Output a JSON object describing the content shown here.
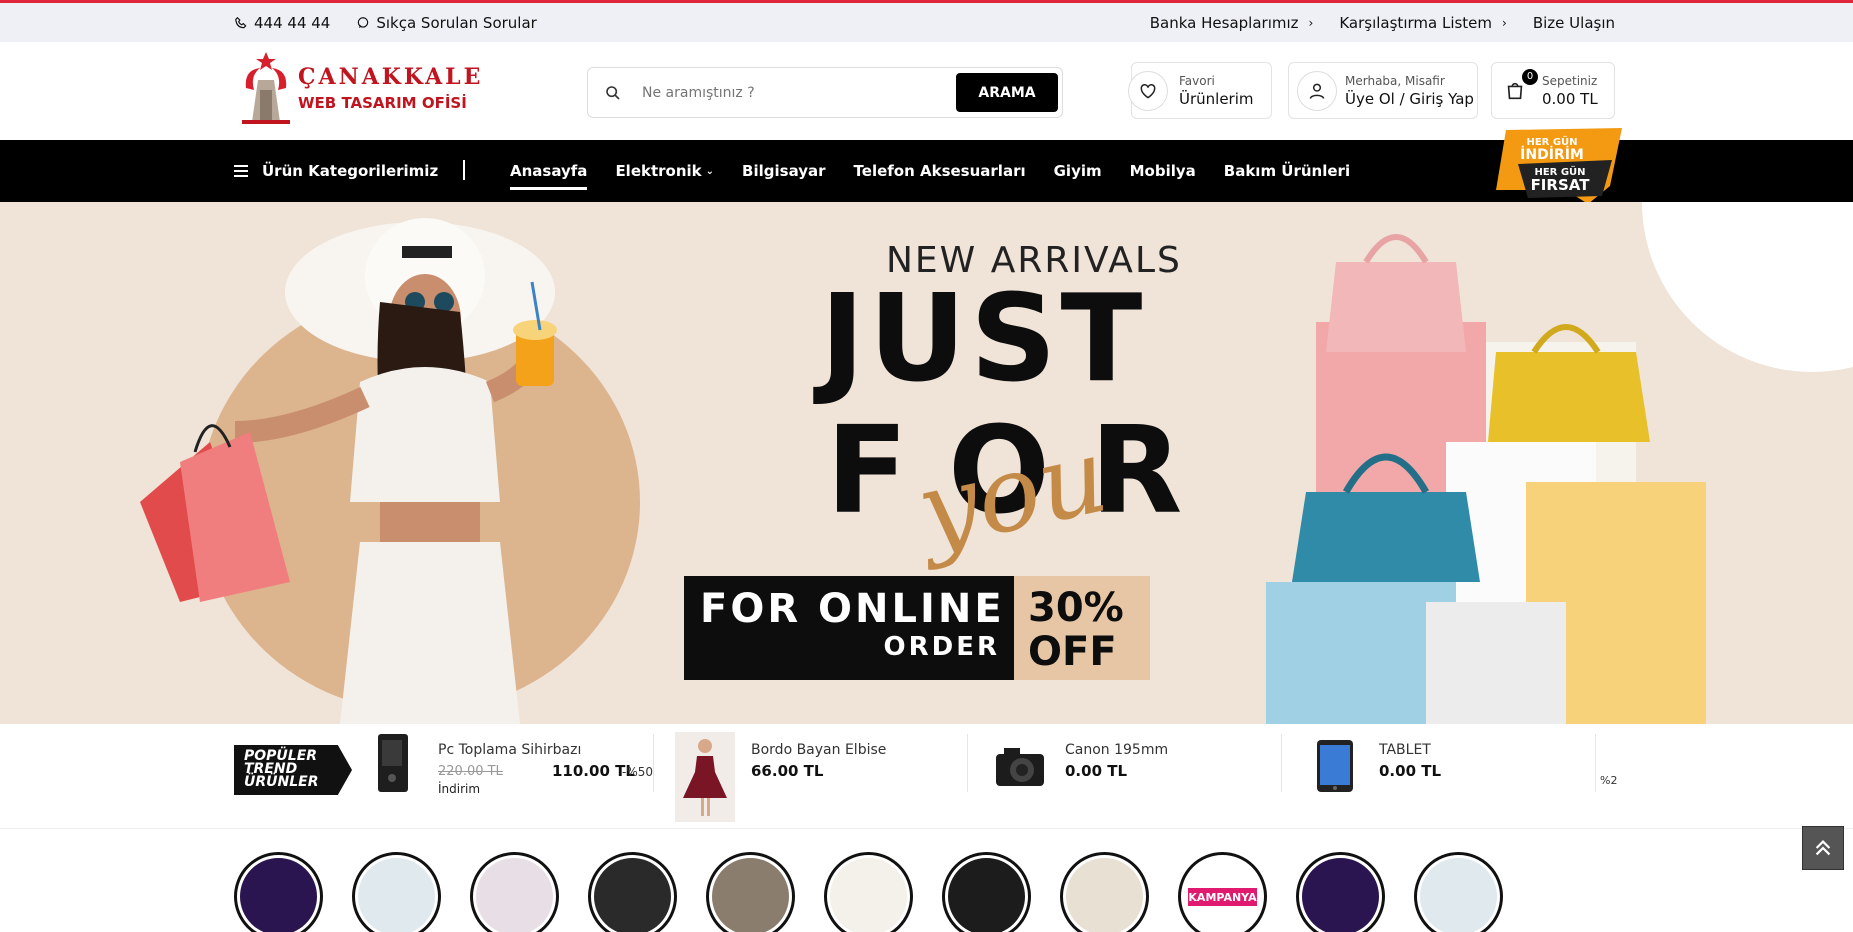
{
  "topbar": {
    "phone": "444 44 44",
    "faq": "Sıkça Sorulan Sorular",
    "links": [
      "Banka Hesaplarımız",
      "Karşılaştırma Listem",
      "Bize Ulaşın"
    ]
  },
  "logo": {
    "line1": "ÇANAKKALE",
    "line2": "WEB TASARIM OFİSİ"
  },
  "search": {
    "placeholder": "Ne aramıştınız ?",
    "button": "ARAMA"
  },
  "favorites": {
    "small": "Favori",
    "big": "Ürünlerim"
  },
  "account": {
    "small": "Merhaba, Misafir",
    "big": "Üye Ol / Giriş Yap"
  },
  "cart": {
    "count": "0",
    "small": "Sepetiniz",
    "big": "0.00 TL"
  },
  "nav": {
    "categories_label": "Ürün Kategorilerimiz",
    "links": [
      "Anasayfa",
      "Elektronik",
      "Bilgisayar",
      "Telefon Aksesuarları",
      "Giyim",
      "Mobilya",
      "Bakım Ürünleri"
    ],
    "promo_line1": "HER GÜN",
    "promo_line2": "İNDİRİM",
    "promo_line3": "HER GÜN",
    "promo_line4": "FIRSAT"
  },
  "hero": {
    "new_arrivals": "NEW ARRIVALS",
    "just": "JUST",
    "for": "FOR",
    "you": "you",
    "online": "FOR ONLINE",
    "order": "ORDER",
    "pct": "30%",
    "off": "OFF"
  },
  "trend": {
    "tag_lines": [
      "POPÜLER",
      "TREND",
      "ÜRÜNLER"
    ],
    "items": [
      {
        "name": "Pc Toplama Sihirbazı",
        "old_price": "220.00 TL",
        "price": "110.00 TL",
        "discount": "-%50",
        "label": "İndirim"
      },
      {
        "name": "Bordo Bayan Elbise",
        "price": "66.00 TL"
      },
      {
        "name": "Canon 195mm",
        "price": "0.00 TL"
      },
      {
        "name": "TABLET",
        "price": "0.00 TL"
      }
    ],
    "trailing": "%2"
  },
  "stories": {
    "kampanya": "KAMPANYA",
    "colors": [
      "#2b1550",
      "#dfe9ee",
      "#e8dfe6",
      "#2a2a2a",
      "#8a7d6e",
      "#f4f0ea",
      "#1c1c1c",
      "#e9e0d4",
      "#ffffff",
      "#2b1550",
      "#dfe9ee"
    ]
  },
  "colors": {
    "accent": "#e0263a",
    "brand_red": "#c0141f",
    "nav_bg": "#000000",
    "hero_bg": "#f0e3d8",
    "you_color": "#c48a47",
    "off_bg": "#e7c6a6"
  }
}
